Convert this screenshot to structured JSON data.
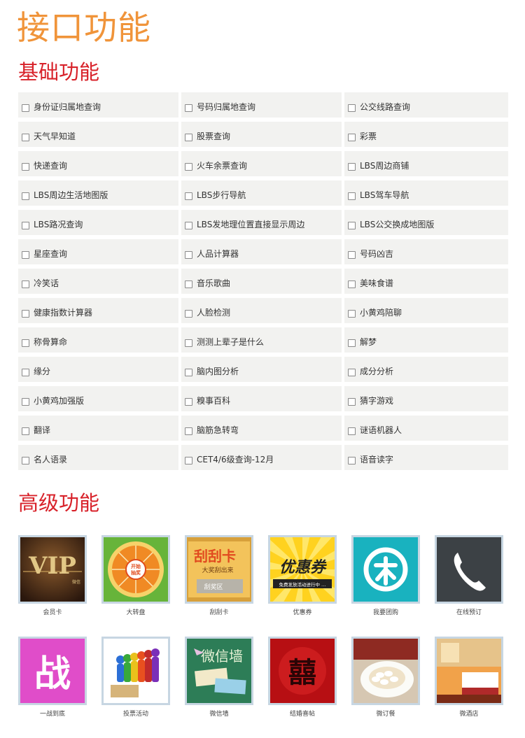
{
  "page_title": "接口功能",
  "basic": {
    "title": "基础功能",
    "items": [
      "身份证归属地查询",
      "号码归属地查询",
      "公交线路查询",
      "天气早知道",
      "股票查询",
      "彩票",
      "快递查询",
      "火车余票查询",
      "LBS周边商铺",
      "LBS周边生活地图版",
      "LBS步行导航",
      "LBS驾车导航",
      "LBS路况查询",
      "LBS发地理位置直接显示周边",
      "LBS公交换成地图版",
      "星座查询",
      "人品计算器",
      "号码凶吉",
      "冷笑话",
      "音乐歌曲",
      "美味食谱",
      "健康指数计算器",
      "人脸检测",
      "小黄鸡陪聊",
      "称骨算命",
      "测测上辈子是什么",
      "解梦",
      "缘分",
      "脑内图分析",
      "成分分析",
      "小黄鸡加强版",
      "糗事百科",
      "猜字游戏",
      "翻译",
      "脑筋急转弯",
      "谜语机器人",
      "名人语录",
      "CET4/6级查询-12月",
      "语音读字"
    ]
  },
  "advanced": {
    "title": "高级功能",
    "row1": [
      {
        "label": "会员卡",
        "icon": "vip-card-icon",
        "art": "VIP",
        "art_sub": "微信"
      },
      {
        "label": "大转盘",
        "icon": "lucky-wheel-icon",
        "art": "开始\n抽奖"
      },
      {
        "label": "刮刮卡",
        "icon": "scratch-card-icon",
        "art": "刮刮卡",
        "art_sub": "大奖刮出来",
        "art_sub2": "刮奖区"
      },
      {
        "label": "优惠券",
        "icon": "coupon-icon",
        "art": "优惠券",
        "art_sub": "免费发放活动进行中 …"
      },
      {
        "label": "我要团购",
        "icon": "group-buy-icon"
      },
      {
        "label": "在线预订",
        "icon": "phone-icon"
      }
    ],
    "row2": [
      {
        "label": "一战到底",
        "icon": "battle-icon",
        "art": "战"
      },
      {
        "label": "投票活动",
        "icon": "vote-icon"
      },
      {
        "label": "微信墙",
        "icon": "wechat-wall-icon",
        "art": "微信墙"
      },
      {
        "label": "结婚喜帖",
        "icon": "wedding-invite-icon",
        "art": "囍"
      },
      {
        "label": "微订餐",
        "icon": "food-order-icon"
      },
      {
        "label": "微酒店",
        "icon": "hotel-icon"
      }
    ]
  },
  "colors": {
    "page_title": "#f0943a",
    "section_title": "#d8222a",
    "cell_bg": "#f2f2f0",
    "thumb_border": "#c7d6e2"
  }
}
